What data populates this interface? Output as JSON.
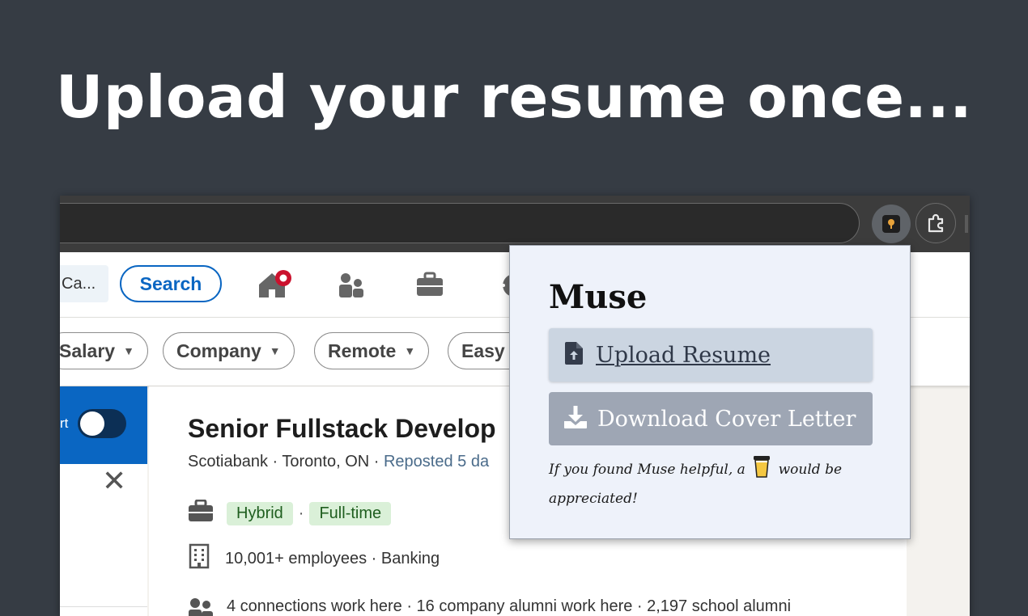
{
  "headline": "Upload your resume once...",
  "linkedin": {
    "search_value": "Ca...",
    "search_button": "Search",
    "filters": [
      "Salary",
      "Company",
      "Remote",
      "Easy"
    ],
    "alert_text_fragment": "rt",
    "job": {
      "title": "Senior Fullstack Develop",
      "company_location": "Scotiabank · Toronto, ON · ",
      "reposted": "Reposted 5 da",
      "workplace": "Hybrid",
      "job_type": "Full-time",
      "company_info": "10,001+ employees · Banking",
      "connections": "4 connections work here · 16 company alumni work here · 2,197 school alumni"
    }
  },
  "popup": {
    "title": "Muse",
    "upload_label": "Upload Resume",
    "download_label": "Download Cover Letter",
    "note_before": "If you found Muse helpful, a",
    "note_after": "would be appreciated!"
  },
  "colors": {
    "background": "#363c44",
    "linkedin_blue": "#0a66c2",
    "popup_bg": "#eef2fa",
    "upload_btn": "#cbd5e1",
    "download_btn_disabled": "#9ea6b4",
    "tag_green": "#daf0d8"
  }
}
